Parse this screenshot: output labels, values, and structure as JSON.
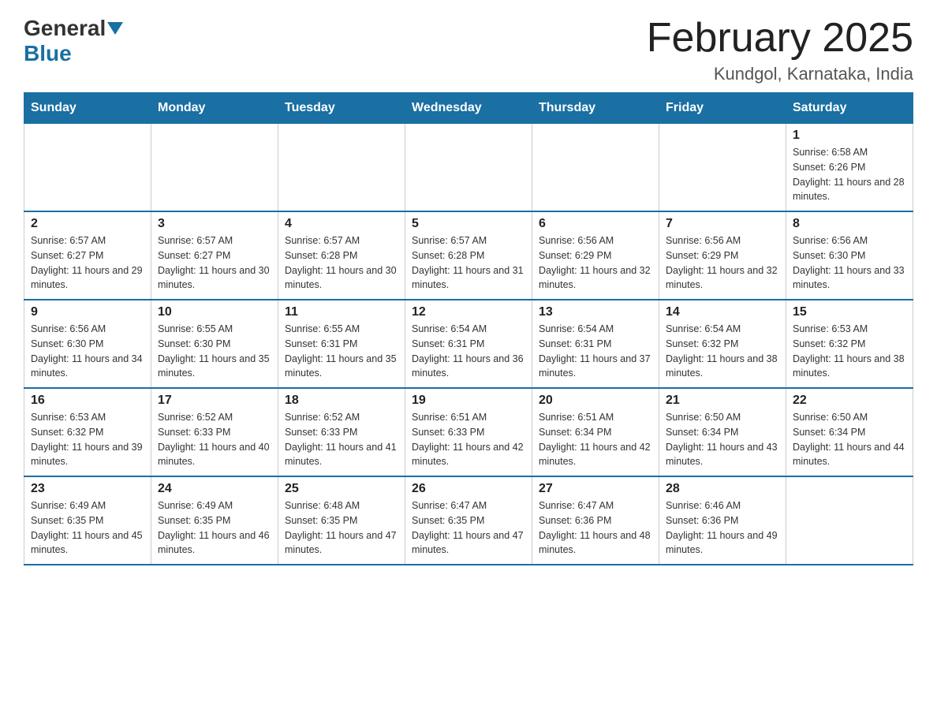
{
  "header": {
    "logo_general": "General",
    "logo_blue": "Blue",
    "month_title": "February 2025",
    "location": "Kundgol, Karnataka, India"
  },
  "weekdays": [
    "Sunday",
    "Monday",
    "Tuesday",
    "Wednesday",
    "Thursday",
    "Friday",
    "Saturday"
  ],
  "weeks": [
    [
      null,
      null,
      null,
      null,
      null,
      null,
      {
        "day": "1",
        "sunrise": "6:58 AM",
        "sunset": "6:26 PM",
        "daylight": "11 hours and 28 minutes."
      }
    ],
    [
      {
        "day": "2",
        "sunrise": "6:57 AM",
        "sunset": "6:27 PM",
        "daylight": "11 hours and 29 minutes."
      },
      {
        "day": "3",
        "sunrise": "6:57 AM",
        "sunset": "6:27 PM",
        "daylight": "11 hours and 30 minutes."
      },
      {
        "day": "4",
        "sunrise": "6:57 AM",
        "sunset": "6:28 PM",
        "daylight": "11 hours and 30 minutes."
      },
      {
        "day": "5",
        "sunrise": "6:57 AM",
        "sunset": "6:28 PM",
        "daylight": "11 hours and 31 minutes."
      },
      {
        "day": "6",
        "sunrise": "6:56 AM",
        "sunset": "6:29 PM",
        "daylight": "11 hours and 32 minutes."
      },
      {
        "day": "7",
        "sunrise": "6:56 AM",
        "sunset": "6:29 PM",
        "daylight": "11 hours and 32 minutes."
      },
      {
        "day": "8",
        "sunrise": "6:56 AM",
        "sunset": "6:30 PM",
        "daylight": "11 hours and 33 minutes."
      }
    ],
    [
      {
        "day": "9",
        "sunrise": "6:56 AM",
        "sunset": "6:30 PM",
        "daylight": "11 hours and 34 minutes."
      },
      {
        "day": "10",
        "sunrise": "6:55 AM",
        "sunset": "6:30 PM",
        "daylight": "11 hours and 35 minutes."
      },
      {
        "day": "11",
        "sunrise": "6:55 AM",
        "sunset": "6:31 PM",
        "daylight": "11 hours and 35 minutes."
      },
      {
        "day": "12",
        "sunrise": "6:54 AM",
        "sunset": "6:31 PM",
        "daylight": "11 hours and 36 minutes."
      },
      {
        "day": "13",
        "sunrise": "6:54 AM",
        "sunset": "6:31 PM",
        "daylight": "11 hours and 37 minutes."
      },
      {
        "day": "14",
        "sunrise": "6:54 AM",
        "sunset": "6:32 PM",
        "daylight": "11 hours and 38 minutes."
      },
      {
        "day": "15",
        "sunrise": "6:53 AM",
        "sunset": "6:32 PM",
        "daylight": "11 hours and 38 minutes."
      }
    ],
    [
      {
        "day": "16",
        "sunrise": "6:53 AM",
        "sunset": "6:32 PM",
        "daylight": "11 hours and 39 minutes."
      },
      {
        "day": "17",
        "sunrise": "6:52 AM",
        "sunset": "6:33 PM",
        "daylight": "11 hours and 40 minutes."
      },
      {
        "day": "18",
        "sunrise": "6:52 AM",
        "sunset": "6:33 PM",
        "daylight": "11 hours and 41 minutes."
      },
      {
        "day": "19",
        "sunrise": "6:51 AM",
        "sunset": "6:33 PM",
        "daylight": "11 hours and 42 minutes."
      },
      {
        "day": "20",
        "sunrise": "6:51 AM",
        "sunset": "6:34 PM",
        "daylight": "11 hours and 42 minutes."
      },
      {
        "day": "21",
        "sunrise": "6:50 AM",
        "sunset": "6:34 PM",
        "daylight": "11 hours and 43 minutes."
      },
      {
        "day": "22",
        "sunrise": "6:50 AM",
        "sunset": "6:34 PM",
        "daylight": "11 hours and 44 minutes."
      }
    ],
    [
      {
        "day": "23",
        "sunrise": "6:49 AM",
        "sunset": "6:35 PM",
        "daylight": "11 hours and 45 minutes."
      },
      {
        "day": "24",
        "sunrise": "6:49 AM",
        "sunset": "6:35 PM",
        "daylight": "11 hours and 46 minutes."
      },
      {
        "day": "25",
        "sunrise": "6:48 AM",
        "sunset": "6:35 PM",
        "daylight": "11 hours and 47 minutes."
      },
      {
        "day": "26",
        "sunrise": "6:47 AM",
        "sunset": "6:35 PM",
        "daylight": "11 hours and 47 minutes."
      },
      {
        "day": "27",
        "sunrise": "6:47 AM",
        "sunset": "6:36 PM",
        "daylight": "11 hours and 48 minutes."
      },
      {
        "day": "28",
        "sunrise": "6:46 AM",
        "sunset": "6:36 PM",
        "daylight": "11 hours and 49 minutes."
      },
      null
    ]
  ]
}
